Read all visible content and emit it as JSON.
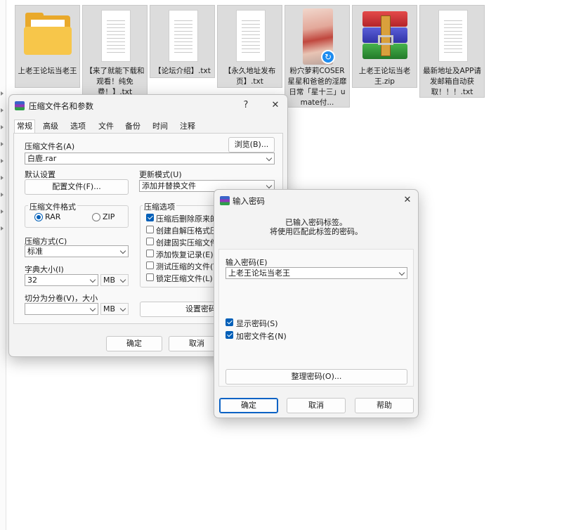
{
  "files": [
    {
      "name": "上老王论坛当老王",
      "icon": "folder-icon"
    },
    {
      "name": "【来了就能下载和观看！纯免费！】.txt",
      "icon": "text-file-icon"
    },
    {
      "name": "【论坛介绍】.txt",
      "icon": "text-file-icon"
    },
    {
      "name": "【永久地址发布页】.txt",
      "icon": "text-file-icon"
    },
    {
      "name": "粉穴萝莉COSER星星和爸爸的淫靡日常「星十三」umate付...",
      "icon": "video-thumbnail-icon"
    },
    {
      "name": "上老王论坛当老王.zip",
      "icon": "winrar-archive-icon"
    },
    {
      "name": "最新地址及APP请发邮箱自动获取！！！.txt",
      "icon": "text-file-icon"
    }
  ],
  "archive_dialog": {
    "title": "压缩文件名和参数",
    "help_glyph": "?",
    "close_glyph": "✕",
    "tabs": [
      "常规",
      "高级",
      "选项",
      "文件",
      "备份",
      "时间",
      "注释"
    ],
    "archive_name_label": "压缩文件名(A)",
    "browse_button": "浏览(B)...",
    "archive_name_value": "白鹿.rar",
    "default_settings_label": "默认设置",
    "profiles_button": "配置文件(F)...",
    "update_mode_label": "更新模式(U)",
    "update_mode_value": "添加并替换文件",
    "format_group_label": "压缩文件格式",
    "format_rar": "RAR",
    "format_zip": "ZIP",
    "options_group_label": "压缩选项",
    "options": [
      {
        "label": "压缩后删除原来的文",
        "checked": true
      },
      {
        "label": "创建自解压格式压缩",
        "checked": false
      },
      {
        "label": "创建固实压缩文件(S",
        "checked": false
      },
      {
        "label": "添加恢复记录(E)",
        "checked": false
      },
      {
        "label": "测试压缩的文件(T)",
        "checked": false
      },
      {
        "label": "锁定压缩文件(L)",
        "checked": false
      }
    ],
    "method_label": "压缩方式(C)",
    "method_value": "标准",
    "dict_label": "字典大小(I)",
    "dict_value": "32",
    "dict_unit": "MB",
    "split_label": "切分为分卷(V)，大小",
    "split_value": "",
    "split_unit": "MB",
    "set_password_button": "设置密码(",
    "ok_button": "确定",
    "cancel_button": "取消"
  },
  "password_dialog": {
    "title": "输入密码",
    "close_glyph": "✕",
    "info_line1": "已输入密码标签。",
    "info_line2": "将使用匹配此标签的密码。",
    "password_label": "输入密码(E)",
    "password_value": "上老王论坛当老王",
    "show_password_label": "显示密码(S)",
    "show_password_checked": true,
    "encrypt_names_label": "加密文件名(N)",
    "encrypt_names_checked": true,
    "organize_button": "整理密码(O)...",
    "ok_button": "确定",
    "cancel_button": "取消",
    "help_button": "帮助"
  }
}
